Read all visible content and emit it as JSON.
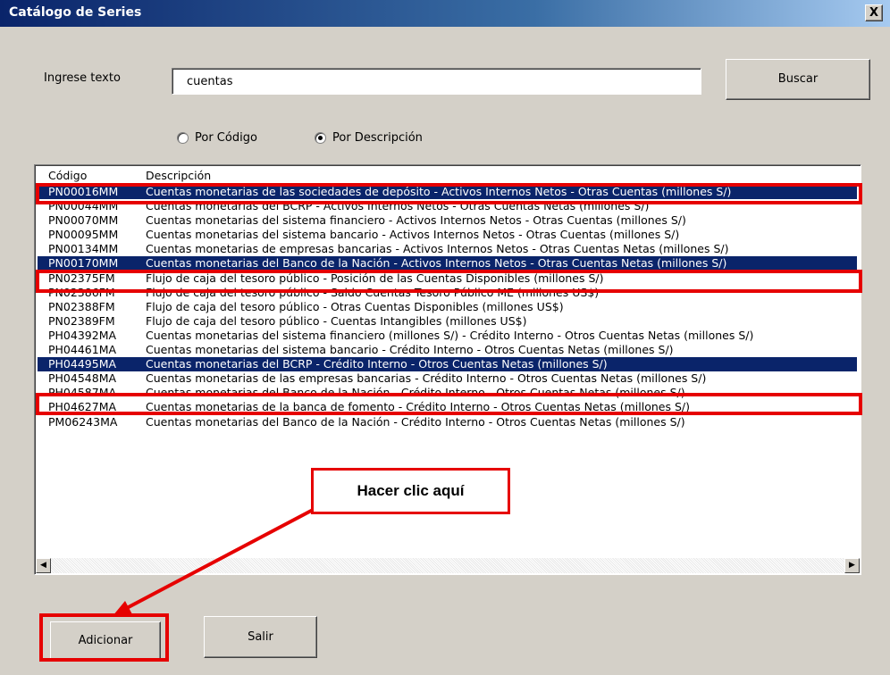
{
  "window": {
    "title": "Catálogo de Series",
    "close_label": "X"
  },
  "search": {
    "label": "Ingrese texto",
    "value": "cuentas",
    "button_label": "Buscar"
  },
  "radio": {
    "option_code": "Por Código",
    "option_desc": "Por Descripción",
    "selected": "Por Descripción"
  },
  "list": {
    "header_code": "Código",
    "header_desc": "Descripción",
    "rows": [
      {
        "code": "PN00016MM",
        "desc": "Cuentas monetarias de las sociedades de depósito - Activos Internos Netos - Otras Cuentas (millones S/)",
        "selected": true
      },
      {
        "code": "PN00044MM",
        "desc": "Cuentas monetarias del BCRP - Activos Internos Netos - Otras Cuentas Netas (millones S/)",
        "selected": false
      },
      {
        "code": "PN00070MM",
        "desc": "Cuentas monetarias del sistema financiero - Activos Internos Netos - Otras Cuentas (millones S/)",
        "selected": false
      },
      {
        "code": "PN00095MM",
        "desc": "Cuentas monetarias del sistema bancario - Activos Internos Netos - Otras Cuentas (millones S/)",
        "selected": false
      },
      {
        "code": "PN00134MM",
        "desc": "Cuentas monetarias de empresas bancarias - Activos Internos Netos - Otras Cuentas Netas (millones S/)",
        "selected": false
      },
      {
        "code": "PN00170MM",
        "desc": "Cuentas monetarias del Banco de la Nación - Activos Internos Netos - Otras Cuentas Netas (millones S/)",
        "selected": true
      },
      {
        "code": "PN02375FM",
        "desc": "Flujo de caja del tesoro público - Posición de las Cuentas Disponibles (millones S/)",
        "selected": false
      },
      {
        "code": "PN02386FM",
        "desc": "Flujo de caja del tesoro público - Saldo Cuentas Tesoro Público ME (millones US$)",
        "selected": false
      },
      {
        "code": "PN02388FM",
        "desc": "Flujo de caja del tesoro público - Otras Cuentas Disponibles (millones US$)",
        "selected": false
      },
      {
        "code": "PN02389FM",
        "desc": "Flujo de caja del tesoro público - Cuentas Intangibles (millones US$)",
        "selected": false
      },
      {
        "code": "PH04392MA",
        "desc": "Cuentas monetarias del sistema financiero (millones S/) - Crédito Interno - Otros Cuentas Netas (millones S/)",
        "selected": false
      },
      {
        "code": "PH04461MA",
        "desc": "Cuentas monetarias del sistema bancario - Crédito Interno - Otros Cuentas Netas (millones S/)",
        "selected": false
      },
      {
        "code": "PH04495MA",
        "desc": "Cuentas monetarias del BCRP - Crédito Interno - Otros Cuentas Netas (millones S/)",
        "selected": true
      },
      {
        "code": "PH04548MA",
        "desc": "Cuentas monetarias de las empresas bancarias - Crédito Interno - Otros Cuentas Netas (millones S/)",
        "selected": false
      },
      {
        "code": "PH04587MA",
        "desc": "Cuentas monetarias del Banco de la Nación - Crédito Interno - Otros Cuentas Netas (millones S/)",
        "selected": false
      },
      {
        "code": "PH04627MA",
        "desc": "Cuentas monetarias de la banca de fomento - Crédito Interno - Otros Cuentas Netas (millones S/)",
        "selected": false
      },
      {
        "code": "PM06243MA",
        "desc": "Cuentas monetarias del Banco de la Nación - Crédito Interno - Otros Cuentas Netas (millones S/)",
        "selected": false
      }
    ]
  },
  "buttons": {
    "add_label": "Adicionar",
    "exit_label": "Salir"
  },
  "annotation": {
    "callout_text": "Hacer clic aquí"
  },
  "colors": {
    "selection": "#0a246a",
    "annotation": "#e60000",
    "dialog_bg": "#d4d0c8"
  },
  "icons": {
    "close": "close-icon",
    "scroll_left": "arrow-left-icon",
    "scroll_right": "arrow-right-icon"
  }
}
